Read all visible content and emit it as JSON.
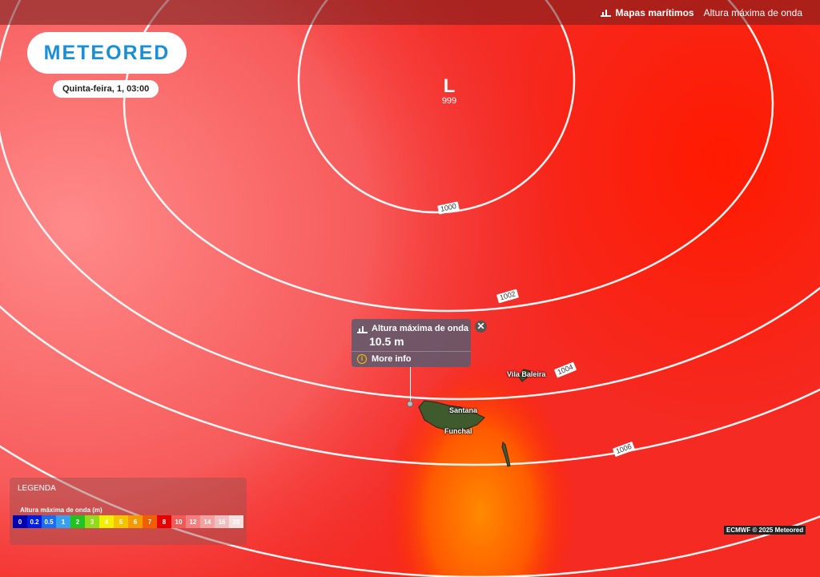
{
  "topbar": {
    "maps_label": "Mapas marítimos",
    "layer_label": "Altura máxima de onda"
  },
  "brand": {
    "logo_text": "METEORED"
  },
  "time": {
    "label": "Quinta-feira, 1, 03:00"
  },
  "low_pressure": {
    "symbol": "L",
    "value": "999"
  },
  "isobars": [
    {
      "value": "1000"
    },
    {
      "value": "1002"
    },
    {
      "value": "1004"
    },
    {
      "value": "1006"
    }
  ],
  "popup": {
    "title": "Altura máxima de onda",
    "value": "10.5 m",
    "more_info": "More info",
    "close": "✕"
  },
  "places": [
    "Vila Baleira",
    "Santana",
    "Funchal"
  ],
  "legend": {
    "title": "LEGENDA",
    "subtitle": "Altura máxima de onda (m)",
    "items": [
      {
        "label": "0",
        "color": "#0000b0"
      },
      {
        "label": "0.2",
        "color": "#0020e0"
      },
      {
        "label": "0.5",
        "color": "#1a6cf0"
      },
      {
        "label": "1",
        "color": "#39a0f0"
      },
      {
        "label": "2",
        "color": "#1fc41f"
      },
      {
        "label": "3",
        "color": "#8fdc1a"
      },
      {
        "label": "4",
        "color": "#f0f000"
      },
      {
        "label": "5",
        "color": "#f4c400"
      },
      {
        "label": "6",
        "color": "#f39a00"
      },
      {
        "label": "7",
        "color": "#f06000"
      },
      {
        "label": "8",
        "color": "#e60000"
      },
      {
        "label": "10",
        "color": "#f25a5a"
      },
      {
        "label": "12",
        "color": "#f28080"
      },
      {
        "label": "14",
        "color": "#f2a0a0"
      },
      {
        "label": "16",
        "color": "#f0c0c0"
      },
      {
        "label": "20",
        "color": "#f5e0e0"
      }
    ]
  },
  "credit": "ECMWF © 2025 Meteored",
  "colors": {
    "logo_blue": "#1b8fd4",
    "sea_base": "#f22"
  }
}
